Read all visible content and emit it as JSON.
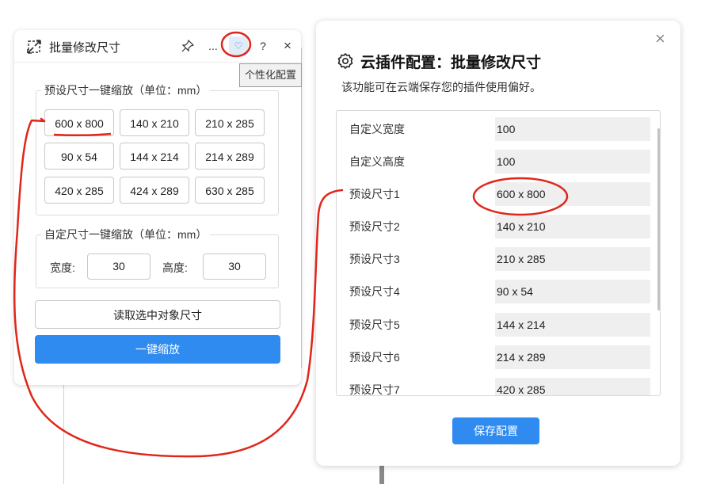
{
  "plugin_panel": {
    "title": "批量修改尺寸",
    "header_buttons": {
      "pin_icon": "pin-icon",
      "more": "...",
      "heart": "♡",
      "help": "?",
      "close": "×"
    },
    "tooltip": "个性化配置",
    "preset_group": {
      "legend": "预设尺寸一键缩放（单位：mm）",
      "sizes": [
        "600 x 800",
        "140 x 210",
        "210 x 285",
        "90 x 54",
        "144 x 214",
        "214 x 289",
        "420 x 285",
        "424 x 289",
        "630 x 285"
      ]
    },
    "custom_group": {
      "legend": "自定尺寸一键缩放（单位：mm）",
      "width_label": "宽度:",
      "width_value": "30",
      "height_label": "高度:",
      "height_value": "30"
    },
    "read_button": "读取选中对象尺寸",
    "scale_button": "一键缩放"
  },
  "cloud_config": {
    "title": "云插件配置：批量修改尺寸",
    "subtitle": "该功能可在云端保存您的插件使用偏好。",
    "rows": [
      {
        "label": "自定义宽度",
        "value": "100"
      },
      {
        "label": "自定义高度",
        "value": "100"
      },
      {
        "label": "预设尺寸1",
        "value": "600 x 800"
      },
      {
        "label": "预设尺寸2",
        "value": "140 x 210"
      },
      {
        "label": "预设尺寸3",
        "value": "210 x 285"
      },
      {
        "label": "预设尺寸4",
        "value": "90 x 54"
      },
      {
        "label": "预设尺寸5",
        "value": "144 x 214"
      },
      {
        "label": "预设尺寸6",
        "value": "214 x 289"
      },
      {
        "label": "预设尺寸7",
        "value": "420 x 285"
      }
    ],
    "save_button": "保存配置",
    "close": "×"
  },
  "colors": {
    "primary": "#2f8bf0",
    "annotation": "#e0261b"
  }
}
